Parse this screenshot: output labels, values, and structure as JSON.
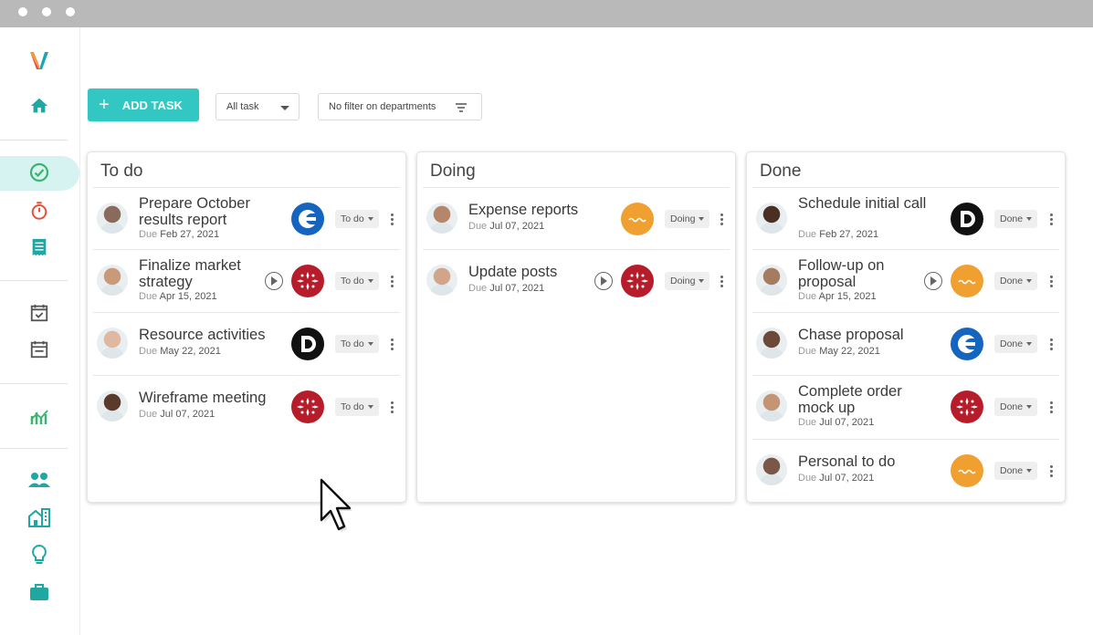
{
  "toolbar": {
    "add_task_label": "ADD TASK",
    "task_filter": "All task",
    "department_filter": "No filter on departments"
  },
  "sidebar": {
    "icons": [
      "logo",
      "home-icon",
      "check-circle-icon",
      "timer-icon",
      "receipt-icon",
      "calendar-check-icon",
      "calendar-icon",
      "chart-icon",
      "users-icon",
      "buildings-icon",
      "lightbulb-icon",
      "briefcase-icon"
    ],
    "accent": "#2fb9b5",
    "active_item": "check-circle-icon"
  },
  "columns": [
    {
      "title": "To do",
      "tasks": [
        {
          "title": "Prepare October results report",
          "due_label": "Due",
          "due": "Feb 27, 2021",
          "status": "To do",
          "dept": "blue-g",
          "timer": false
        },
        {
          "title": "Finalize market strategy",
          "due_label": "Due",
          "due": "Apr 15, 2021",
          "status": "To do",
          "dept": "red-stars",
          "timer": true
        },
        {
          "title": "Resource activities",
          "due_label": "Due",
          "due": "May 22, 2021",
          "status": "To do",
          "dept": "black-d",
          "timer": false
        },
        {
          "title": "Wireframe meeting",
          "due_label": "Due",
          "due": "Jul 07, 2021",
          "status": "To do",
          "dept": "red-stars",
          "timer": false
        }
      ]
    },
    {
      "title": "Doing",
      "tasks": [
        {
          "title": "Expense reports",
          "due_label": "Due",
          "due": "Jul 07, 2021",
          "status": "Doing",
          "dept": "orange-wave",
          "timer": false
        },
        {
          "title": "Update posts",
          "due_label": "Due",
          "due": "Jul 07, 2021",
          "status": "Doing",
          "dept": "red-stars",
          "timer": true
        }
      ]
    },
    {
      "title": "Done",
      "tasks": [
        {
          "title": "Schedule initial call",
          "due_label": "Due",
          "due": "Feb 27, 2021",
          "status": "Done",
          "dept": "black-d",
          "timer": false
        },
        {
          "title": "Follow-up on proposal",
          "due_label": "Due",
          "due": "Apr 15, 2021",
          "status": "Done",
          "dept": "orange-wave",
          "timer": true
        },
        {
          "title": "Chase proposal",
          "due_label": "Due",
          "due": "May 22, 2021",
          "status": "Done",
          "dept": "blue-g",
          "timer": false
        },
        {
          "title": "Complete order mock up",
          "due_label": "Due",
          "due": "Jul 07, 2021",
          "status": "Done",
          "dept": "red-stars",
          "timer": false
        },
        {
          "title": "Personal to do",
          "due_label": "Due",
          "due": "Jul 07, 2021",
          "status": "Done",
          "dept": "orange-wave",
          "timer": false
        }
      ]
    }
  ],
  "colors": {
    "primary": "#33c7c3",
    "dept_blue": "#1565c0",
    "dept_red": "#b71c2a",
    "dept_orange": "#f0a030",
    "dept_black": "#111111"
  }
}
